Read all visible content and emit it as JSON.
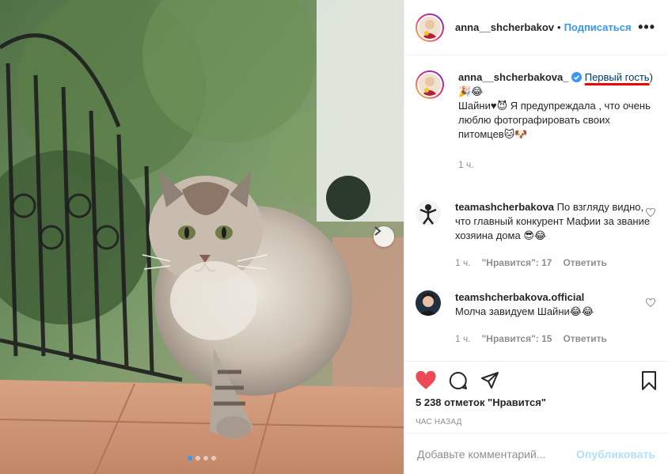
{
  "post": {
    "photo_alt": "cat-photo",
    "carousel": {
      "total": 4,
      "active": 1
    }
  },
  "header": {
    "username": "anna__shcherbakov",
    "separator": "•",
    "follow_label": "Подписаться",
    "more_icon": "more-horizontal-icon"
  },
  "caption": {
    "username": "anna__shcherbakova_",
    "verified_icon": "verified-badge-icon",
    "underlined_text": "Первый гость",
    "text_after": ")🎉😂",
    "body": "Шайни♥😈 Я предупреждала , что очень люблю фотографировать своих питомцев🐱🐶",
    "time": "1 ч."
  },
  "comments": [
    {
      "username": "teamashcherbakova",
      "text": "По взгляду видно, что главный конкурент Мафии за звание хозяина дома 😎😂",
      "time": "1 ч.",
      "likes": "\"Нравится\": 17",
      "reply": "Ответить"
    },
    {
      "username": "teamshcherbakova.official",
      "text": "Молча завидуем Шайни😂😂",
      "time": "1 ч.",
      "likes": "\"Нравится\": 15",
      "reply": "Ответить"
    }
  ],
  "actions": {
    "like_icon": "heart-filled-icon",
    "comment_icon": "comment-icon",
    "share_icon": "share-icon",
    "save_icon": "bookmark-icon",
    "likes_count": "5 238 отметок \"Нравится\"",
    "time_ago": "ЧАС НАЗАД"
  },
  "add_comment": {
    "placeholder": "Добавьте комментарий...",
    "publish_label": "Опубликовать"
  },
  "colors": {
    "accent": "#3897f0",
    "like_red": "#ed4956",
    "publish_disabled": "#b2dffc",
    "muted": "#8e8e8e"
  }
}
